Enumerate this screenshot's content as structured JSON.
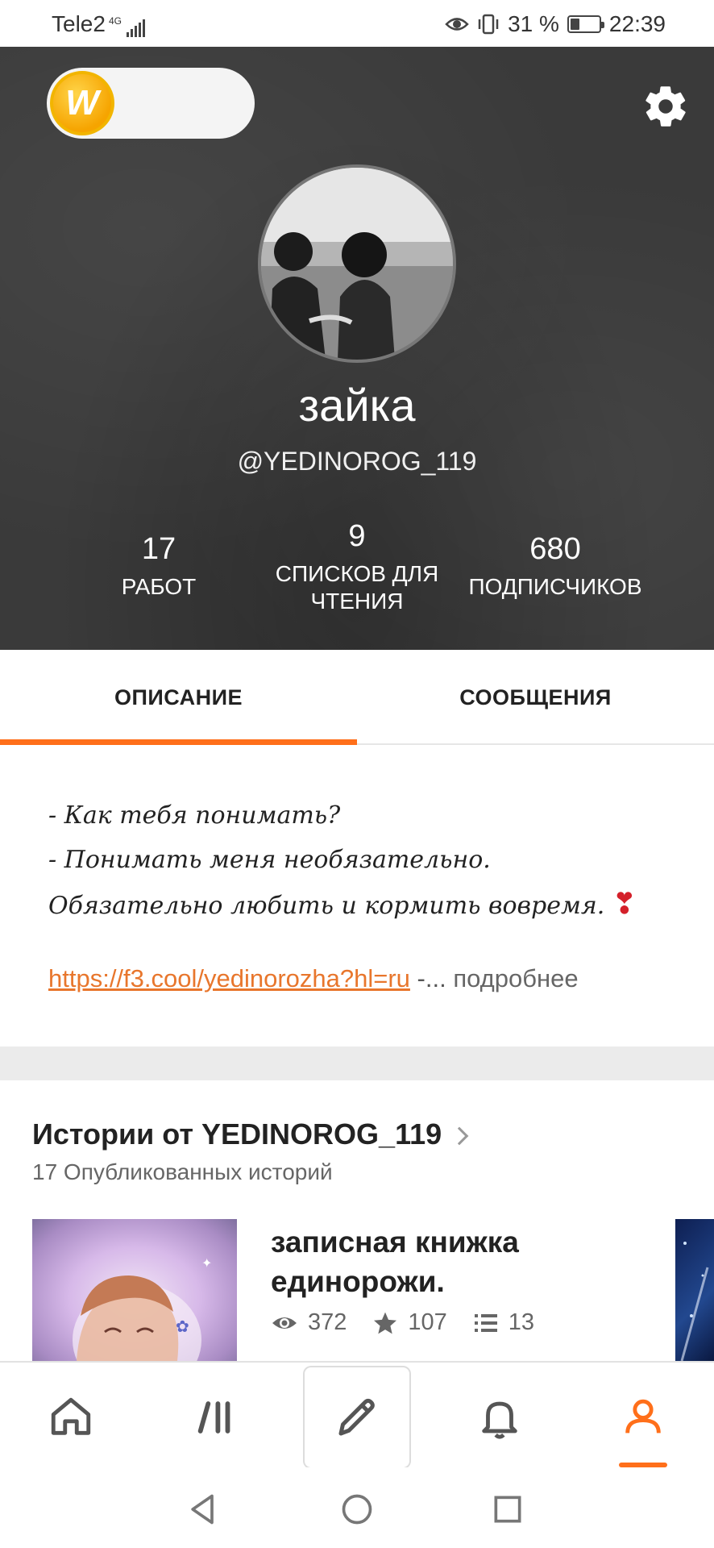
{
  "status_bar": {
    "carrier": "Tele2",
    "network": "4G",
    "battery": "31 %",
    "battery_level": 0.31,
    "time": "22:39",
    "icons": [
      "eye-comfort-icon",
      "vibrate-icon",
      "battery-icon",
      "signal-icon"
    ]
  },
  "header": {
    "coin_icon": "W",
    "settings_icon": "gear-icon",
    "profile_name": "зайка",
    "username": "@YEDINOROG_119",
    "stats": [
      {
        "value": "17",
        "label": "РАБОТ"
      },
      {
        "value": "9",
        "label_line1": "СПИСКОВ ДЛЯ",
        "label_line2": "ЧТЕНИЯ"
      },
      {
        "value": "680",
        "label": "ПОДПИСЧИКОВ"
      }
    ]
  },
  "tabs": {
    "description": "ОПИСАНИЕ",
    "messages": "СООБЩЕНИЯ",
    "active": "description"
  },
  "description": {
    "line1": "- Как тебя понимать?",
    "line2": "- Понимать меня необязательно.",
    "line3": "Обязательно любить и кормить вовремя.",
    "heart": "❣",
    "link": "https://f3.cool/yedinorozha?hl=ru",
    "link_suffix": " -...",
    "more": " подробнее"
  },
  "stories": {
    "title": "Истории от YEDINOROG_119",
    "count": "17 Опубликованных историй",
    "items": [
      {
        "title_line1": "записная книжка",
        "title_line2": "единорожи.",
        "views": "372",
        "votes": "107",
        "parts": "13"
      }
    ]
  },
  "bottom_nav": {
    "items": [
      "home-icon",
      "library-icon",
      "write-icon",
      "notifications-icon",
      "profile-icon"
    ],
    "active": "profile-icon"
  },
  "colors": {
    "accent": "#ff6f1a",
    "link": "#e8762c",
    "header_bg": "#3a3a3a"
  }
}
